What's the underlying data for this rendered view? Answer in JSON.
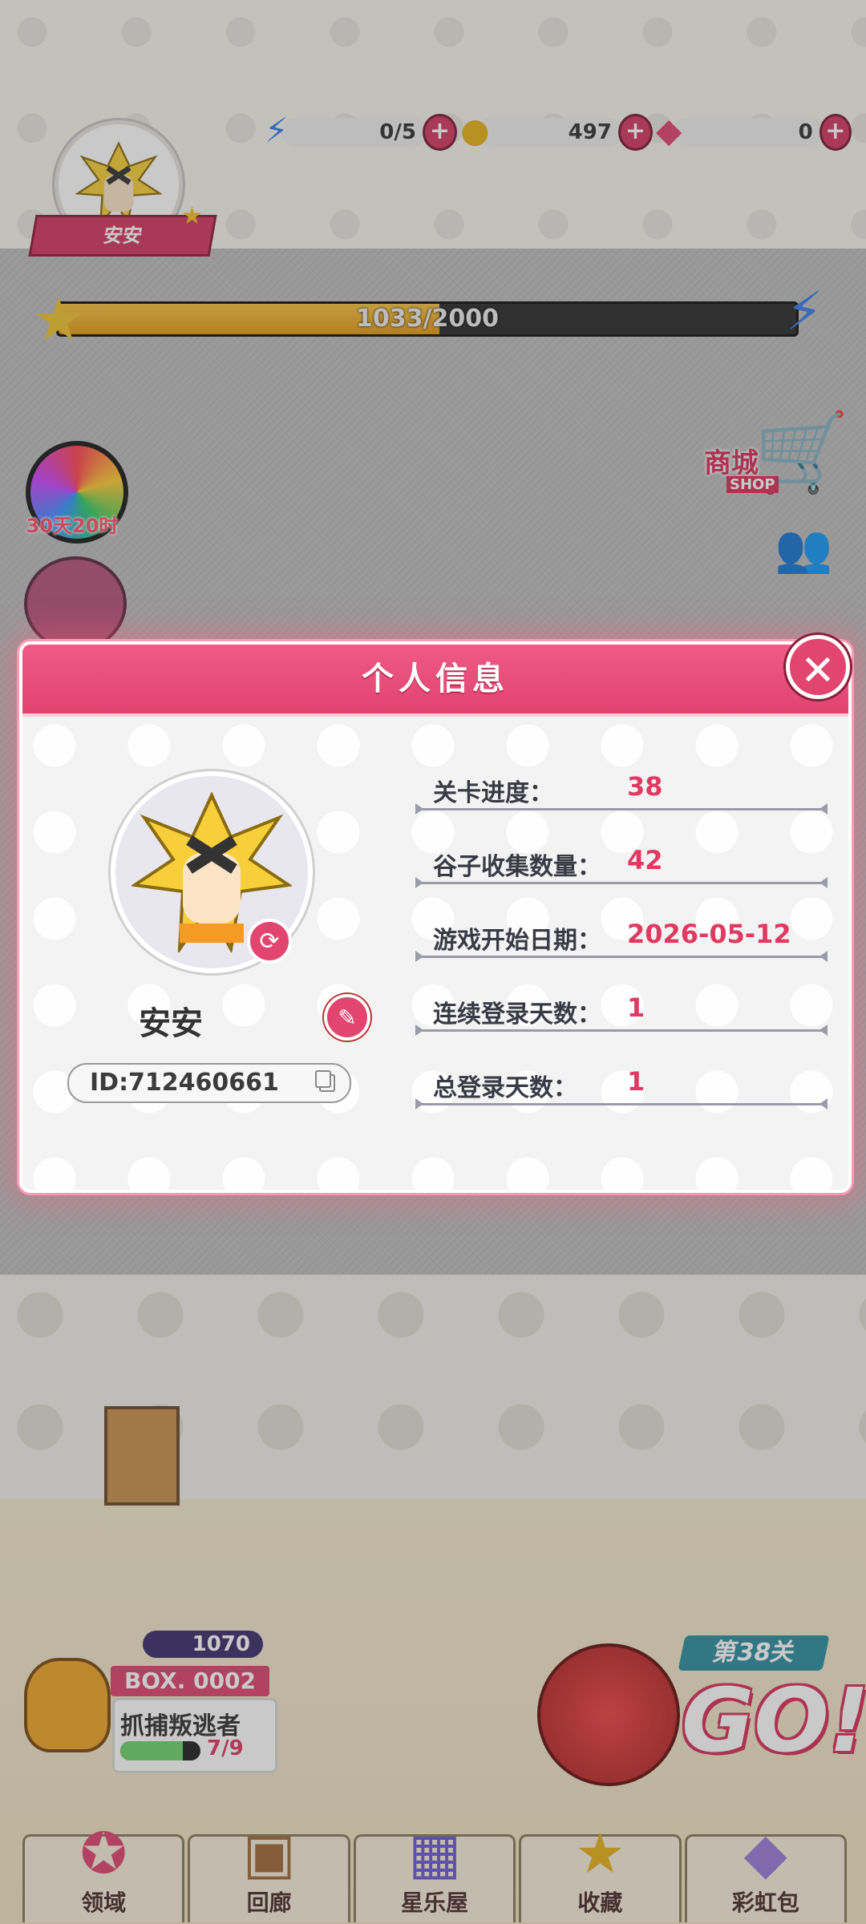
{
  "hud": {
    "player_name": "安安",
    "energy": "0/5",
    "coins": "497",
    "gems": "0",
    "xp_text": "1033/2000",
    "xp_progress": 0.5165
  },
  "side": {
    "event_timer": "30天20时",
    "shop_label": "商城",
    "shop_sub": "SHOP"
  },
  "modal": {
    "title": "个人信息",
    "player_name": "安安",
    "player_id": "ID:712460661",
    "stats": [
      {
        "label": "关卡进度：",
        "value": "38"
      },
      {
        "label": "谷子收集数量：",
        "value": "42"
      },
      {
        "label": "游戏开始日期：",
        "value": "2026-05-12"
      },
      {
        "label": "连续登录天数：",
        "value": "1"
      },
      {
        "label": "总登录天数：",
        "value": "1"
      }
    ]
  },
  "box": {
    "coins": "1070",
    "title": "BOX. 0002",
    "name": "抓捕叛逃者",
    "count": "7/9",
    "progress": 0.7778
  },
  "go": {
    "level": "第38关",
    "label": "GO!"
  },
  "nav": {
    "items": [
      "领域",
      "回廊",
      "星乐屋",
      "收藏",
      "彩虹包"
    ]
  },
  "colors": {
    "accent": "#e2456f",
    "stat_value": "#e03a63",
    "header": "#ef5a86"
  }
}
